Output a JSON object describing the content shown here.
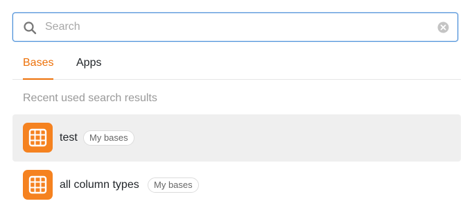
{
  "search": {
    "placeholder": "Search",
    "value": ""
  },
  "tabs": [
    {
      "label": "Bases",
      "active": true
    },
    {
      "label": "Apps",
      "active": false
    }
  ],
  "section_heading": "Recent used search results",
  "results": [
    {
      "name": "test",
      "badge": "My bases",
      "highlighted": true,
      "icon": "table-grid-icon"
    },
    {
      "name": "all column types",
      "badge": "My bases",
      "highlighted": false,
      "icon": "table-grid-icon"
    }
  ],
  "colors": {
    "accent": "#ed7109",
    "base_icon_bg": "#f58220",
    "focus_border": "#4a8fd9",
    "highlight_bg": "#efefef"
  }
}
